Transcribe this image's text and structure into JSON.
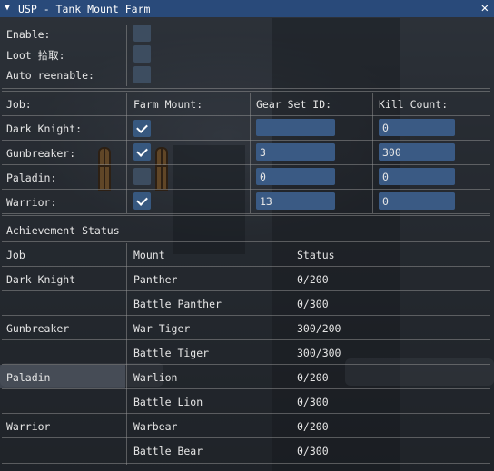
{
  "window": {
    "title": "USP - Tank Mount Farm",
    "collapse_icon": "triangle-down",
    "close_icon": "close-x"
  },
  "settings": [
    {
      "label": "Enable:",
      "checked": false
    },
    {
      "label": "Loot 拾取:",
      "checked": false
    },
    {
      "label": "Auto reenable:",
      "checked": false
    }
  ],
  "jobs_table": {
    "headers": [
      "Job:",
      "Farm Mount:",
      "Gear Set ID:",
      "Kill Count:"
    ],
    "rows": [
      {
        "job": "Dark Knight:",
        "farm_mount": true,
        "gear_set_id": "",
        "kill_count": "0"
      },
      {
        "job": "Gunbreaker:",
        "farm_mount": true,
        "gear_set_id": "3",
        "kill_count": "300"
      },
      {
        "job": "Paladin:",
        "farm_mount": false,
        "gear_set_id": "0",
        "kill_count": "0"
      },
      {
        "job": "Warrior:",
        "farm_mount": true,
        "gear_set_id": "13",
        "kill_count": "0"
      }
    ]
  },
  "achievement": {
    "section_title": "Achievement Status",
    "headers": [
      "Job",
      "Mount",
      "Status"
    ],
    "rows": [
      {
        "job": "Dark Knight",
        "mount": "Panther",
        "status": "0/200"
      },
      {
        "job": "",
        "mount": "Battle Panther",
        "status": "0/300"
      },
      {
        "job": "Gunbreaker",
        "mount": "War Tiger",
        "status": "300/200"
      },
      {
        "job": "",
        "mount": "Battle Tiger",
        "status": "300/300"
      },
      {
        "job": "Paladin",
        "mount": "Warlion",
        "status": "0/200"
      },
      {
        "job": "",
        "mount": "Battle Lion",
        "status": "0/300"
      },
      {
        "job": "Warrior",
        "mount": "Warbear",
        "status": "0/200"
      },
      {
        "job": "",
        "mount": "Battle Bear",
        "status": "0/300"
      }
    ]
  },
  "colors": {
    "titlebar": "#294a7a",
    "checkbox": "#37587f",
    "input": "#3a5a84",
    "text": "#e6e6e6"
  }
}
